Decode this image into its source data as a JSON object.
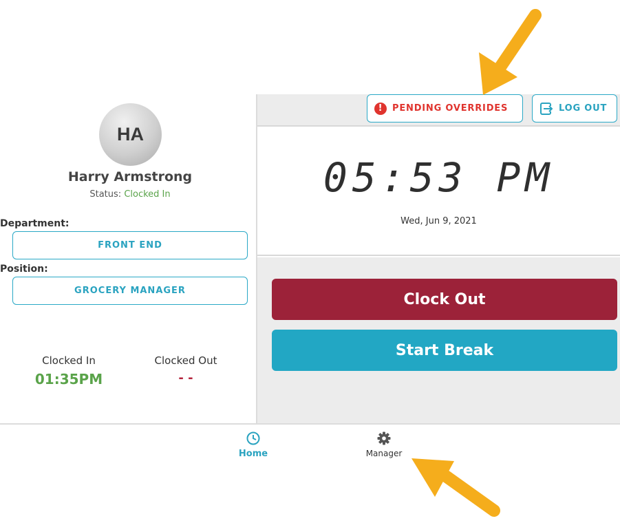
{
  "profile": {
    "initials": "HA",
    "name": "Harry Armstrong",
    "status_prefix": "Status:",
    "status_value": "Clocked In",
    "department_label": "Department:",
    "department_value": "FRONT END",
    "position_label": "Position:",
    "position_value": "GROCERY MANAGER",
    "clocked_in_label": "Clocked In",
    "clocked_in_value": "01:35PM",
    "clocked_out_label": "Clocked Out",
    "clocked_out_value": "- -"
  },
  "header": {
    "pending_overrides_label": "PENDING OVERRIDES",
    "pending_icon_glyph": "!",
    "log_out_label": "LOG OUT"
  },
  "clock": {
    "time": "05:53 PM",
    "date": "Wed, Jun 9, 2021"
  },
  "actions": {
    "clock_out_label": "Clock Out",
    "start_break_label": "Start Break"
  },
  "nav": {
    "home_label": "Home",
    "manager_label": "Manager"
  },
  "colors": {
    "accent": "#29a8c6",
    "clock_out": "#9c2239",
    "start_break": "#22a7c4",
    "clocked_in_green": "#5aa34a",
    "alert_red": "#e0342e",
    "arrow": "#f5ad1c"
  },
  "icons": {
    "pending": "exclamation-circle-icon",
    "logout": "logout-icon",
    "home": "clock-icon",
    "manager": "gear-icon"
  }
}
